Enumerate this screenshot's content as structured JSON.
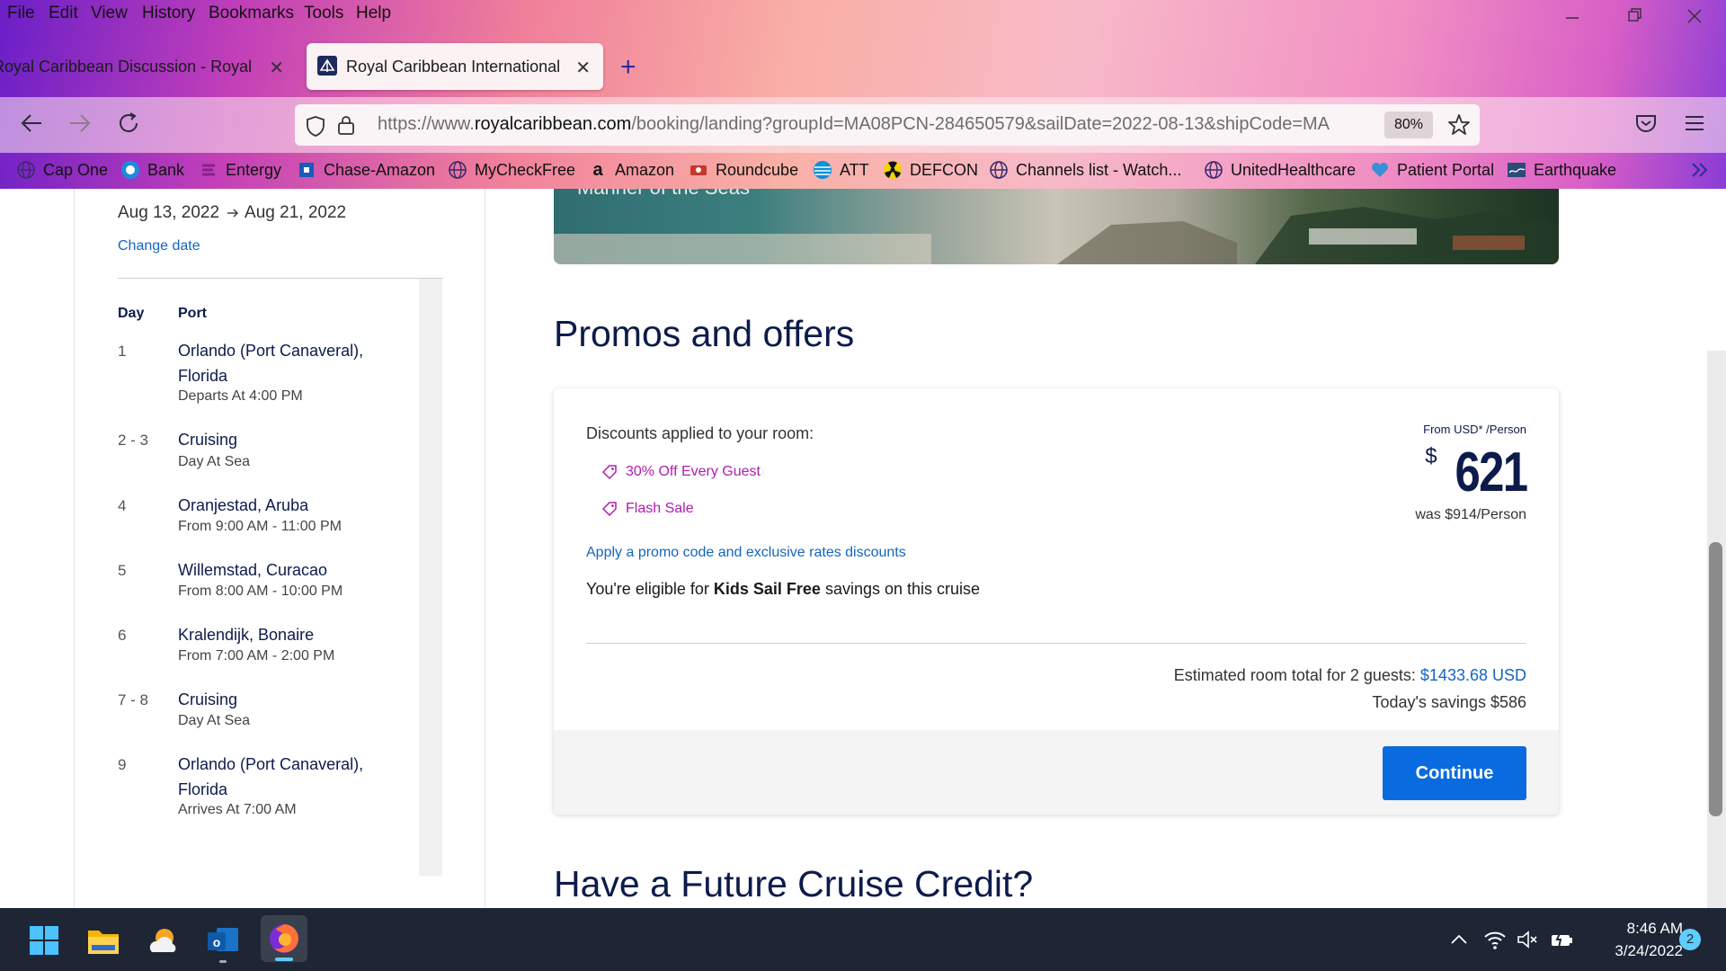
{
  "menu": [
    "File",
    "Edit",
    "View",
    "History",
    "Bookmarks",
    "Tools",
    "Help"
  ],
  "tabs": [
    {
      "title": "Royal Caribbean Discussion - Royal"
    },
    {
      "title": "Royal Caribbean International"
    }
  ],
  "url": {
    "prefix": "https://www.",
    "host": "royalcaribbean.com",
    "path": "/booking/landing?groupId=MA08PCN-284650579&sailDate=2022-08-13&shipCode=MA"
  },
  "zoom": "80%",
  "bookmarks": [
    {
      "label": "Cap One",
      "icon": "globe-icon"
    },
    {
      "label": "Bank",
      "icon": "bank-icon"
    },
    {
      "label": "Entergy",
      "icon": "entergy-icon"
    },
    {
      "label": "Chase-Amazon",
      "icon": "chase-icon"
    },
    {
      "label": "MyCheckFree",
      "icon": "globe-icon"
    },
    {
      "label": "Amazon",
      "icon": "amazon-icon"
    },
    {
      "label": "Roundcube",
      "icon": "roundcube-icon"
    },
    {
      "label": "ATT",
      "icon": "att-icon"
    },
    {
      "label": "DEFCON",
      "icon": "radiation-icon"
    },
    {
      "label": "Channels list - Watch...",
      "icon": "globe-icon"
    },
    {
      "label": "UnitedHealthcare",
      "icon": "globe-icon"
    },
    {
      "label": "Patient Portal",
      "icon": "heart-icon"
    },
    {
      "label": "Earthquake",
      "icon": "usgs-icon"
    }
  ],
  "sidebar": {
    "date_start": "Aug 13, 2022",
    "date_end": "Aug 21, 2022",
    "change_date": "Change date",
    "col_day": "Day",
    "col_port": "Port",
    "itinerary": [
      {
        "day": "1",
        "port": "Orlando (Port Canaveral), Florida",
        "detail": "Departs At 4:00 PM"
      },
      {
        "day": "2 - 3",
        "port": "Cruising",
        "detail": "Day At Sea"
      },
      {
        "day": "4",
        "port": "Oranjestad, Aruba",
        "detail": "From 9:00 AM - 11:00 PM"
      },
      {
        "day": "5",
        "port": "Willemstad, Curacao",
        "detail": "From 8:00 AM - 10:00 PM"
      },
      {
        "day": "6",
        "port": "Kralendijk, Bonaire",
        "detail": "From 7:00 AM - 2:00 PM"
      },
      {
        "day": "7 - 8",
        "port": "Cruising",
        "detail": "Day At Sea"
      },
      {
        "day": "9",
        "port": "Orlando (Port Canaveral), Florida",
        "detail": "Arrives At 7:00 AM"
      }
    ]
  },
  "hero": {
    "ship_name": "Mariner of the Seas"
  },
  "promos": {
    "title": "Promos and offers",
    "discounts_label": "Discounts applied to your room:",
    "discounts": [
      "30% Off Every Guest",
      "Flash Sale"
    ],
    "promo_link": "Apply a promo code and exclusive rates discounts",
    "kids_prefix": "You're eligible for ",
    "kids_bold": "Kids Sail Free",
    "kids_suffix": " savings on this cruise",
    "price_from": "From USD* /Person",
    "currency_symbol": "$",
    "price": "621",
    "was": "was $914/Person",
    "estimate_label": "Estimated room total for 2 guests: ",
    "estimate_value": "$1433.68 USD",
    "savings": "Today's savings $586",
    "continue": "Continue"
  },
  "fcc_title": "Have a Future Cruise Credit?",
  "taskbar": {
    "time": "8:46 AM",
    "date": "3/24/2022",
    "notifications": "2"
  },
  "colors": {
    "accent_blue": "#0a6be0",
    "navy": "#0d1b4b",
    "promo_purple": "#b01cb0",
    "link_blue": "#1565c0"
  }
}
